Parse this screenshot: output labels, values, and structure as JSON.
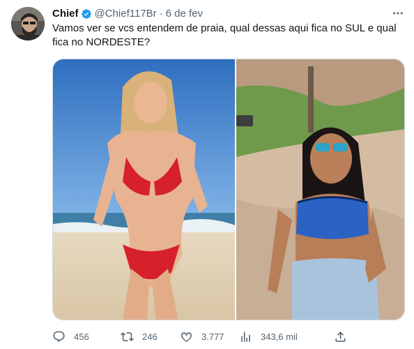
{
  "tweet": {
    "author_name": "Chief",
    "handle": "@Chief117Br",
    "separator": "·",
    "date": "6 de fev",
    "text": "Vamos ver se vcs entendem de praia, qual dessas aqui fica no SUL e qual fica no NORDESTE?"
  },
  "icons": {
    "avatar": "avatar-photo",
    "verified": "verified-badge-icon",
    "more": "more-options-icon",
    "reply": "reply-icon",
    "retweet": "retweet-icon",
    "like": "like-icon",
    "views": "views-icon",
    "share": "share-icon"
  },
  "stats": {
    "replies": "456",
    "retweets": "246",
    "likes": "3.777",
    "views": "343,6 mil"
  },
  "colors": {
    "verified": "#1d9bf0",
    "secondary_text": "#536471",
    "border": "#cfd9de"
  }
}
